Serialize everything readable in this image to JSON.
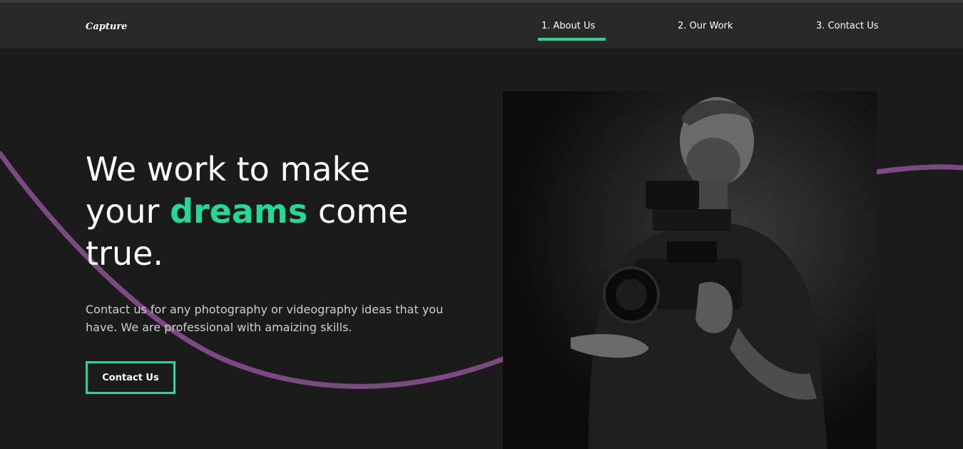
{
  "brand": {
    "logo": "Capture"
  },
  "nav": {
    "items": [
      {
        "label": "1. About Us",
        "active": true
      },
      {
        "label": "2. Our Work",
        "active": false
      },
      {
        "label": "3. Contact Us",
        "active": false
      }
    ]
  },
  "hero": {
    "title_line1": "We work to make",
    "title_pre": "your",
    "title_accent": "dreams",
    "title_post": "come",
    "title_line3": "true.",
    "description": "Contact us for any photography or videography ideas that you have. We are professional with amaizing skills.",
    "cta_label": "Contact Us"
  },
  "colors": {
    "background": "#1b1b1b",
    "nav_background": "#282828",
    "accent": "#23d997",
    "wave": "#7c4a82"
  },
  "icons": {
    "hero_image": "videographer-photo"
  }
}
